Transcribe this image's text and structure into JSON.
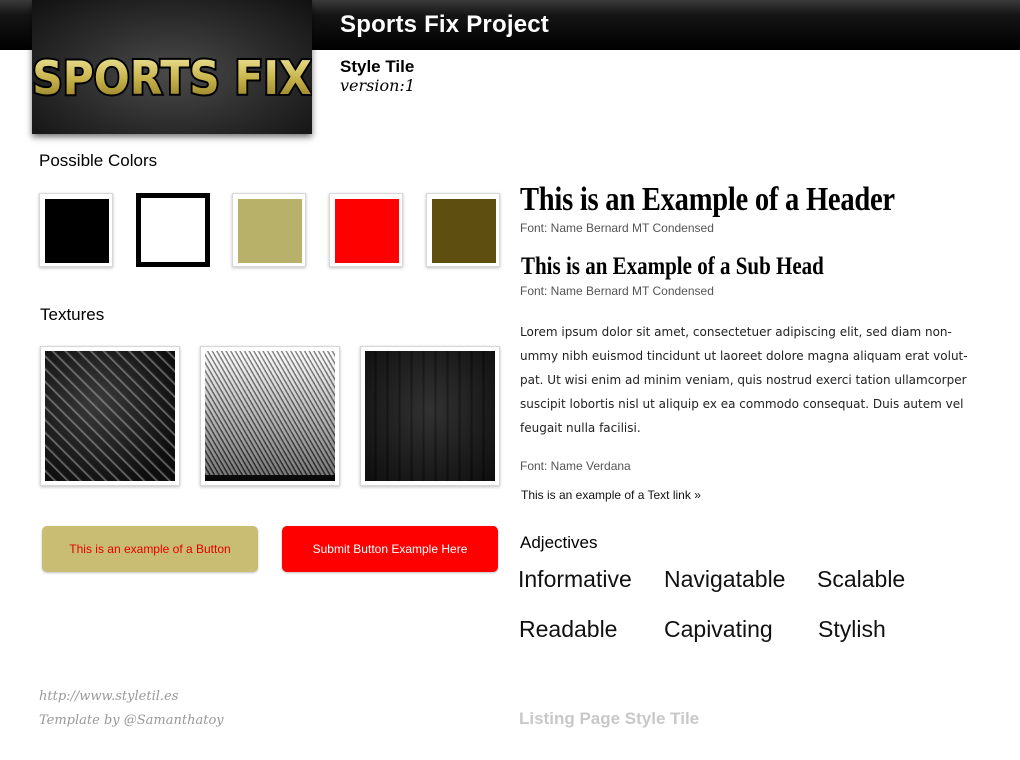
{
  "header": {
    "project_title": "Sports Fix Project",
    "logo_text": "SPORTS FIX",
    "tile_title": "Style Tile",
    "version": "version:1"
  },
  "colors": {
    "label": "Possible Colors",
    "swatches": [
      "#000000",
      "#ffffff",
      "#b8b16a",
      "#ff0000",
      "#5e4e10"
    ]
  },
  "textures": {
    "label": "Textures"
  },
  "buttons": {
    "example_label": "This is an example of a Button",
    "submit_label": "Submit Button Example Here"
  },
  "typography": {
    "header_example": "This is an Example of a Header",
    "header_font_note": "Font: Name Bernard MT Condensed",
    "subhead_example": "This is an Example of a Sub Head",
    "subhead_font_note": "Font: Name Bernard MT Condensed",
    "body_text": "Lorem ipsum dolor sit amet, consectetuer adipiscing elit, sed diam non-ummy nibh euismod tincidunt ut laoreet dolore magna aliquam erat volut-pat. Ut wisi enim ad minim veniam, quis nostrud exerci tation ullamcorper suscipit lobortis nisl ut aliquip ex ea commodo consequat. Duis autem vel feugait nulla facilisi.",
    "body_font_note": "Font: Name Verdana",
    "text_link": "This is an example of a Text link »"
  },
  "adjectives": {
    "label": "Adjectives",
    "items": [
      "Informative",
      "Navigatable",
      "Scalable",
      "Readable",
      "Capivating",
      "Stylish"
    ]
  },
  "footer": {
    "url": "http://www.styletil.es",
    "credit": "Template by @Samanthatoy",
    "page_label": "Listing Page Style Tile"
  }
}
